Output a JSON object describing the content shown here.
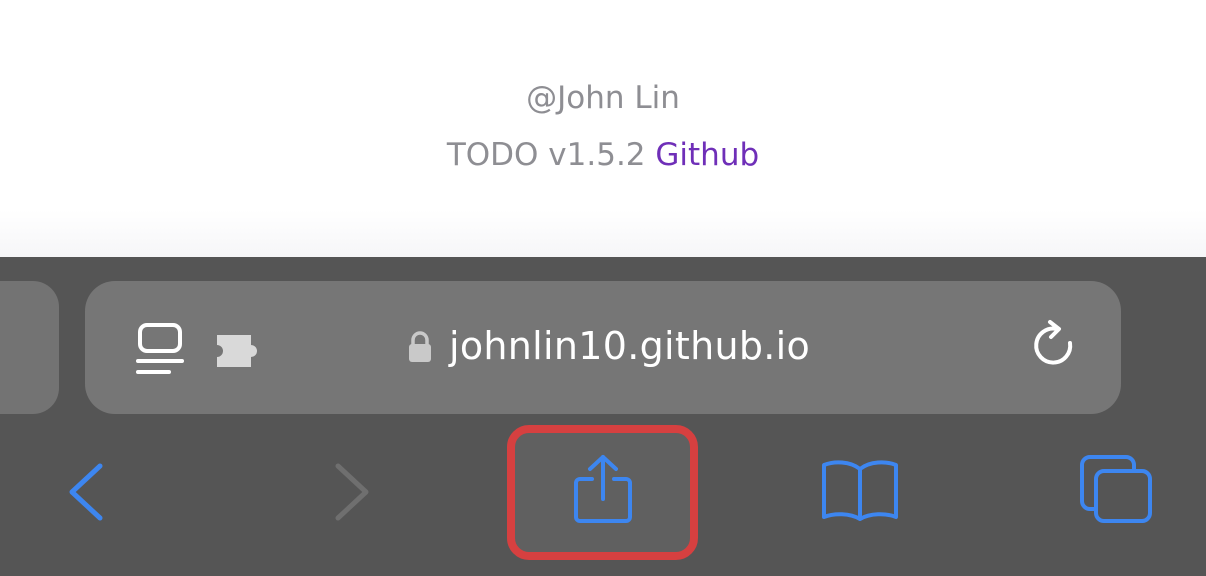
{
  "page": {
    "author": "@John Lin",
    "version_text": "TODO v1.5.2",
    "github_link": "Github"
  },
  "address_bar": {
    "url": "johnlin10.github.io",
    "icons": [
      "reader-mode-icon",
      "extension-icon",
      "lock-icon",
      "reload-icon"
    ]
  },
  "toolbar": {
    "buttons": [
      "back",
      "forward",
      "share",
      "bookmarks",
      "tabs"
    ],
    "share_highlight_color": "#d64040"
  },
  "colors": {
    "accent": "#3d86f0",
    "link": "#6f2fb8",
    "muted_text": "#8e8e93",
    "toolbar_bg": "#555555",
    "address_bar_bg": "#767676"
  }
}
